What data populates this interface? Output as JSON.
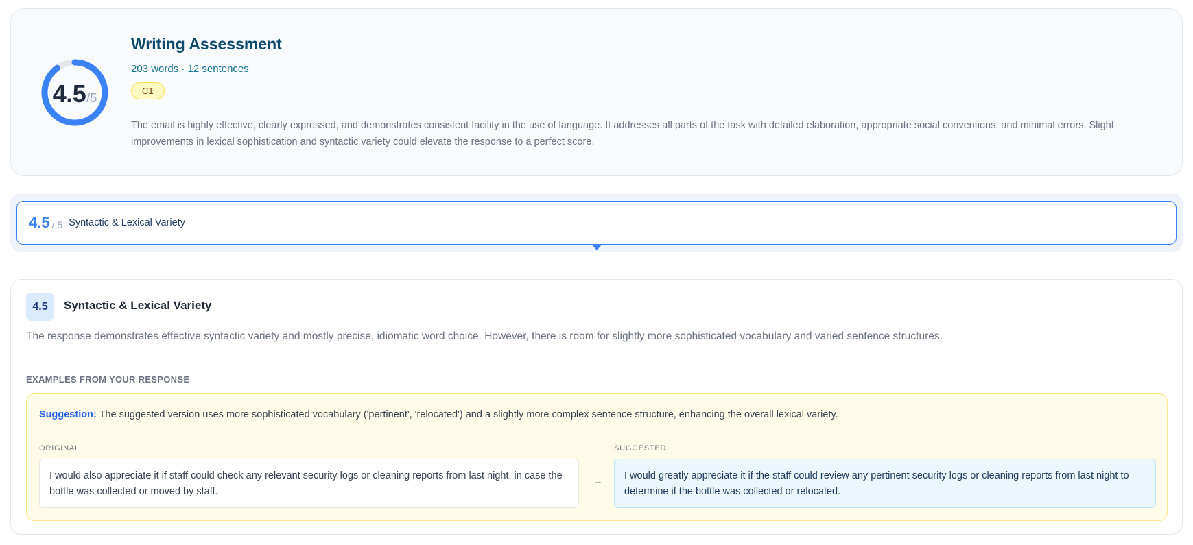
{
  "summary": {
    "score": "4.5",
    "score_max": "/5",
    "score_fraction": 0.9,
    "title": "Writing Assessment",
    "meta": "203 words · 12 sentences",
    "level": "C1",
    "text": "The email is highly effective, clearly expressed, and demonstrates consistent facility in the use of language. It addresses all parts of the task with detailed elaboration, appropriate social conventions, and minimal errors. Slight improvements in lexical sophistication and syntactic variety could elevate the response to a perfect score."
  },
  "criteria_tabs": [
    {
      "score": "4.5",
      "max": "/ 5",
      "label": "Syntactic & Lexical Variety",
      "selected": true
    }
  ],
  "detail": {
    "score": "4.5",
    "title": "Syntactic & Lexical Variety",
    "text": "The response demonstrates effective syntactic variety and mostly precise, idiomatic word choice. However, there is room for slightly more sophisticated vocabulary and varied sentence structures.",
    "examples_heading": "EXAMPLES FROM YOUR RESPONSE",
    "examples": [
      {
        "suggestion_label": "Suggestion:",
        "suggestion_text": "The suggested version uses more sophisticated vocabulary ('pertinent', 'relocated') and a slightly more complex sentence structure, enhancing the overall lexical variety.",
        "original_label": "ORIGINAL",
        "original": "I would also appreciate it if staff could check any relevant security logs or cleaning reports from last night, in case the bottle was collected or moved by staff.",
        "arrow": "→",
        "suggested_label": "SUGGESTED",
        "suggested": "I would greatly appreciate it if the staff could review any pertinent security logs or cleaning reports from last night to determine if the bottle was collected or relocated."
      }
    ]
  },
  "colors": {
    "ring": "#3b82f6",
    "ring_track": "#e5e7eb",
    "accent": "#3b82f6",
    "badge_bg": "#fef9c3"
  }
}
